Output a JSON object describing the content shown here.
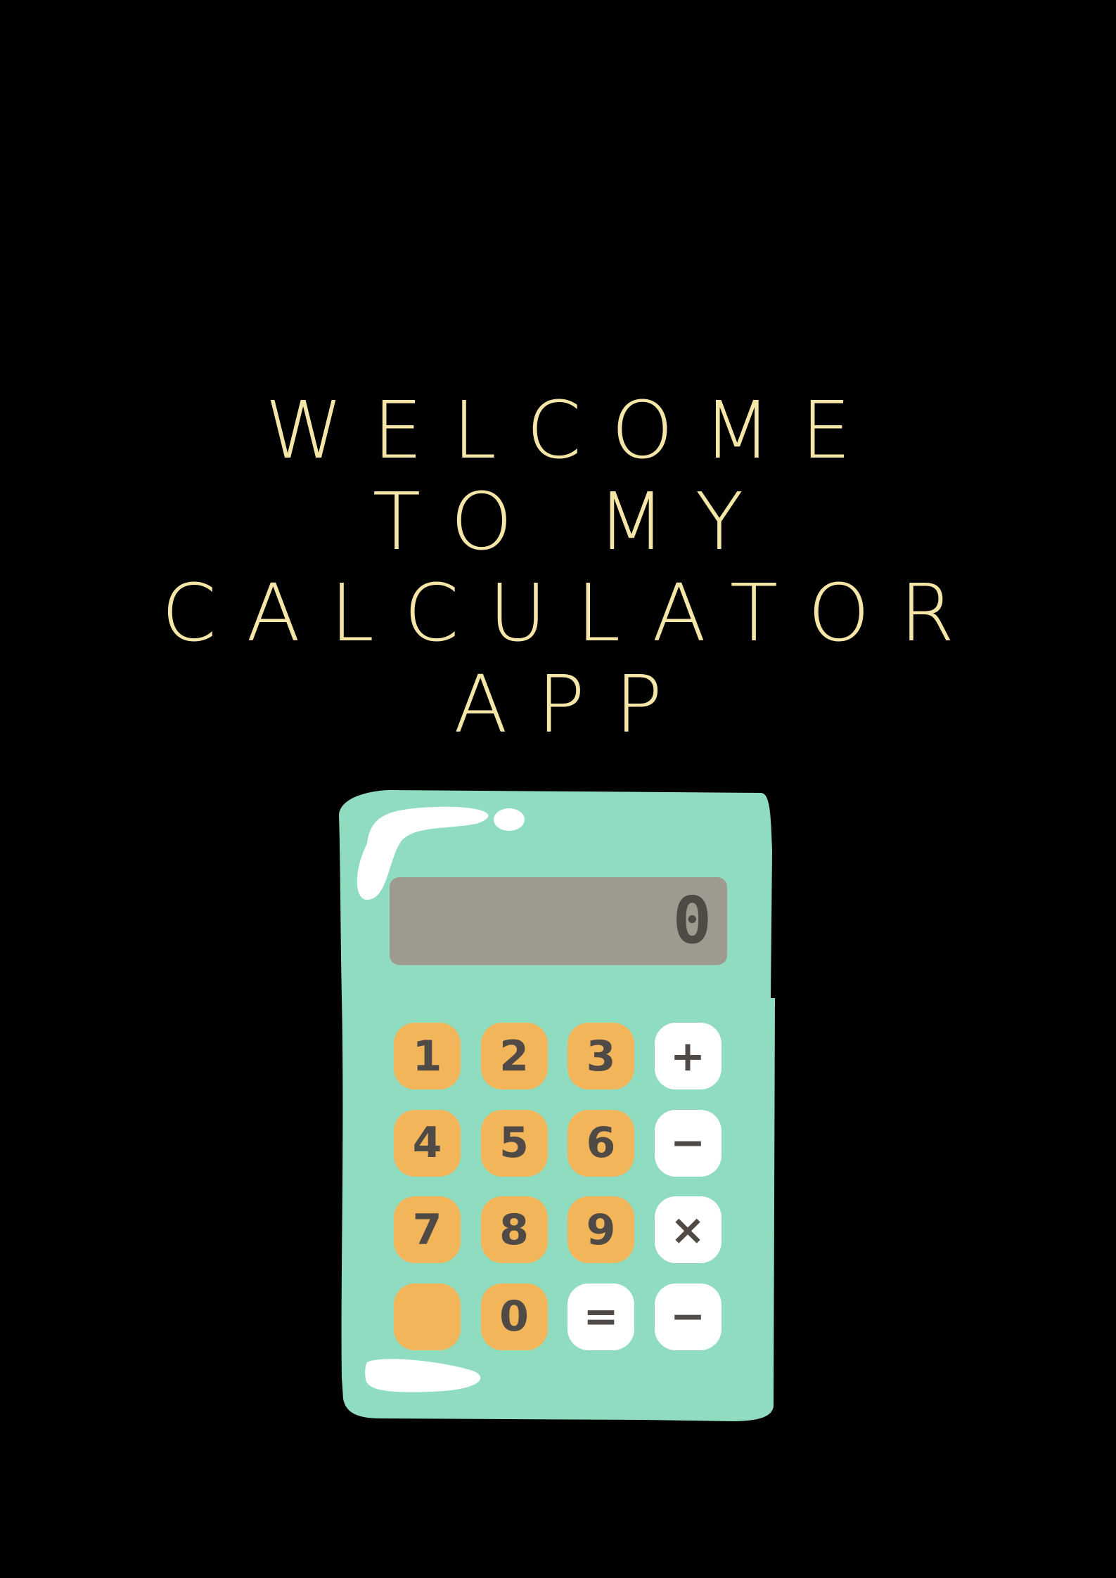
{
  "heading": {
    "lines": [
      "WELCOME",
      "TO MY",
      "CALCULATOR",
      "APP"
    ]
  },
  "calculator": {
    "display_value": "0",
    "keys": [
      {
        "label": "1",
        "kind": "number"
      },
      {
        "label": "2",
        "kind": "number"
      },
      {
        "label": "3",
        "kind": "number"
      },
      {
        "label": "+",
        "kind": "operator"
      },
      {
        "label": "4",
        "kind": "number"
      },
      {
        "label": "5",
        "kind": "number"
      },
      {
        "label": "6",
        "kind": "number"
      },
      {
        "label": "−",
        "kind": "operator"
      },
      {
        "label": "7",
        "kind": "number"
      },
      {
        "label": "8",
        "kind": "number"
      },
      {
        "label": "9",
        "kind": "number"
      },
      {
        "label": "×",
        "kind": "operator"
      },
      {
        "label": "",
        "kind": "number"
      },
      {
        "label": "0",
        "kind": "number"
      },
      {
        "label": "=",
        "kind": "operator"
      },
      {
        "label": "−",
        "kind": "operator"
      }
    ]
  },
  "colors": {
    "background": "#000000",
    "heading_text": "#f5e6a8",
    "calculator_body": "#8fdcc0",
    "display_screen": "#9e9a90",
    "number_key": "#f2b55a",
    "operator_key": "#ffffff",
    "key_text": "#4f4a46"
  }
}
